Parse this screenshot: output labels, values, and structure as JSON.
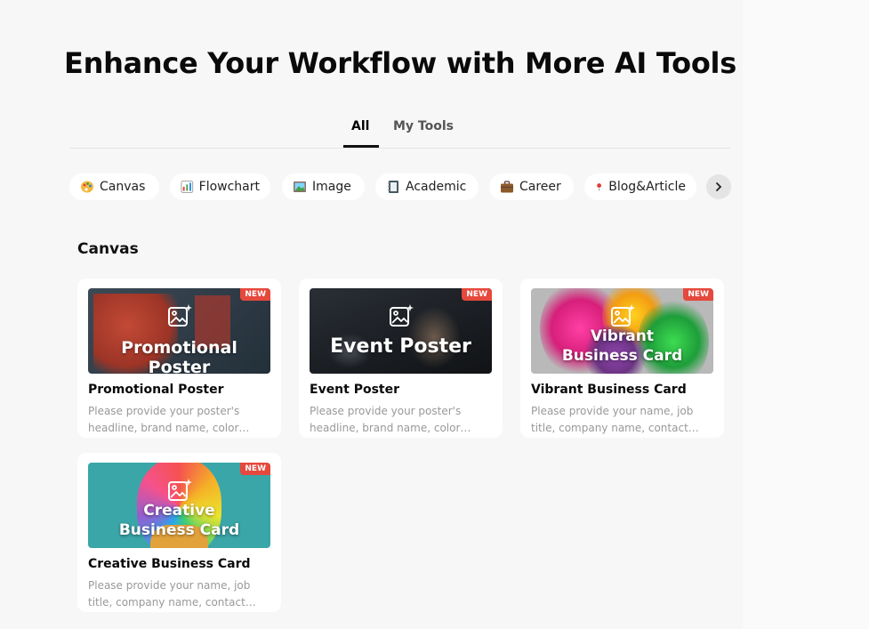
{
  "header": {
    "title": "Enhance Your Workflow with More AI Tools"
  },
  "tabs": [
    {
      "label": "All",
      "active": true
    },
    {
      "label": "My Tools",
      "active": false
    }
  ],
  "categories": [
    {
      "label": "Canvas",
      "icon": "palette-icon"
    },
    {
      "label": "Flowchart",
      "icon": "bar-chart-icon"
    },
    {
      "label": "Image",
      "icon": "picture-icon"
    },
    {
      "label": "Academic",
      "icon": "notebook-icon"
    },
    {
      "label": "Career",
      "icon": "briefcase-icon"
    },
    {
      "label": "Blog&Article",
      "icon": "pushpin-icon"
    }
  ],
  "section": {
    "title": "Canvas"
  },
  "cards": [
    {
      "title": "Promotional Poster",
      "thumb_text": "Promotional Poster",
      "badge": "NEW",
      "description": "Please provide your poster's headline, brand name, color…"
    },
    {
      "title": "Event Poster",
      "thumb_text": "Event Poster",
      "badge": "NEW",
      "description": "Please provide your poster's headline, brand name, color…"
    },
    {
      "title": "Vibrant Business Card",
      "thumb_text_line1": "Vibrant",
      "thumb_text_line2": "Business Card",
      "badge": "NEW",
      "description": "Please provide your name, job title, company name, contact…"
    },
    {
      "title": "Creative Business Card",
      "thumb_text_line1": "Creative",
      "thumb_text_line2": "Business Card",
      "badge": "NEW",
      "description": "Please provide your name, job title, company name, contact…"
    }
  ],
  "colors": {
    "badge": "#e5483c",
    "background": "#f7f7f7",
    "card": "#ffffff"
  }
}
